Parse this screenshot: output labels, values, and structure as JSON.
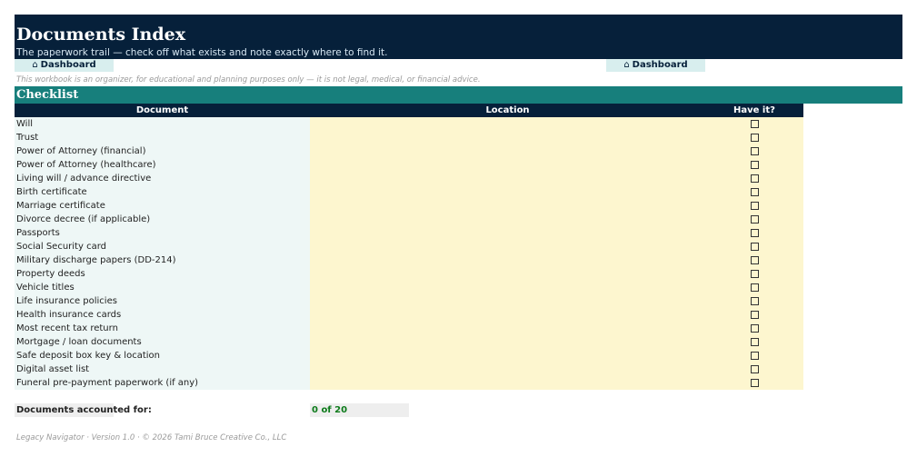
{
  "header": {
    "title": "Documents Index",
    "subtitle": "The paperwork trail — check off what exists and note exactly where to find it."
  },
  "nav": {
    "home_icon": "⌂",
    "dashboard_left": "Dashboard",
    "dashboard_right": "Dashboard"
  },
  "disclaimer": "This workbook is an organizer, for educational and planning purposes only — it is not legal, medical, or financial advice.",
  "section": {
    "title": "Checklist"
  },
  "table": {
    "headers": {
      "document": "Document",
      "location": "Location",
      "have_it": "Have it?"
    },
    "rows": [
      {
        "document": "Will",
        "location": "",
        "have_it": false
      },
      {
        "document": "Trust",
        "location": "",
        "have_it": false
      },
      {
        "document": "Power of Attorney (financial)",
        "location": "",
        "have_it": false
      },
      {
        "document": "Power of Attorney (healthcare)",
        "location": "",
        "have_it": false
      },
      {
        "document": "Living will / advance directive",
        "location": "",
        "have_it": false
      },
      {
        "document": "Birth certificate",
        "location": "",
        "have_it": false
      },
      {
        "document": "Marriage certificate",
        "location": "",
        "have_it": false
      },
      {
        "document": "Divorce decree (if applicable)",
        "location": "",
        "have_it": false
      },
      {
        "document": "Passports",
        "location": "",
        "have_it": false
      },
      {
        "document": "Social Security card",
        "location": "",
        "have_it": false
      },
      {
        "document": "Military discharge papers (DD-214)",
        "location": "",
        "have_it": false
      },
      {
        "document": "Property deeds",
        "location": "",
        "have_it": false
      },
      {
        "document": "Vehicle titles",
        "location": "",
        "have_it": false
      },
      {
        "document": "Life insurance policies",
        "location": "",
        "have_it": false
      },
      {
        "document": "Health insurance cards",
        "location": "",
        "have_it": false
      },
      {
        "document": "Most recent tax return",
        "location": "",
        "have_it": false
      },
      {
        "document": "Mortgage / loan documents",
        "location": "",
        "have_it": false
      },
      {
        "document": "Safe deposit box key & location",
        "location": "",
        "have_it": false
      },
      {
        "document": "Digital asset list",
        "location": "",
        "have_it": false
      },
      {
        "document": "Funeral pre-payment paperwork (if any)",
        "location": "",
        "have_it": false
      }
    ]
  },
  "summary": {
    "label": "Documents accounted for:",
    "value": "0 of 20"
  },
  "footer": "Legacy Navigator · Version 1.0 · © 2026 Tami Bruce Creative Co., LLC",
  "colors": {
    "navy": "#06203a",
    "teal": "#177f7c",
    "doc_column_fill": "#eef7f6",
    "location_column_fill": "#fdf6cf",
    "summary_value": "#0c7a1a"
  }
}
